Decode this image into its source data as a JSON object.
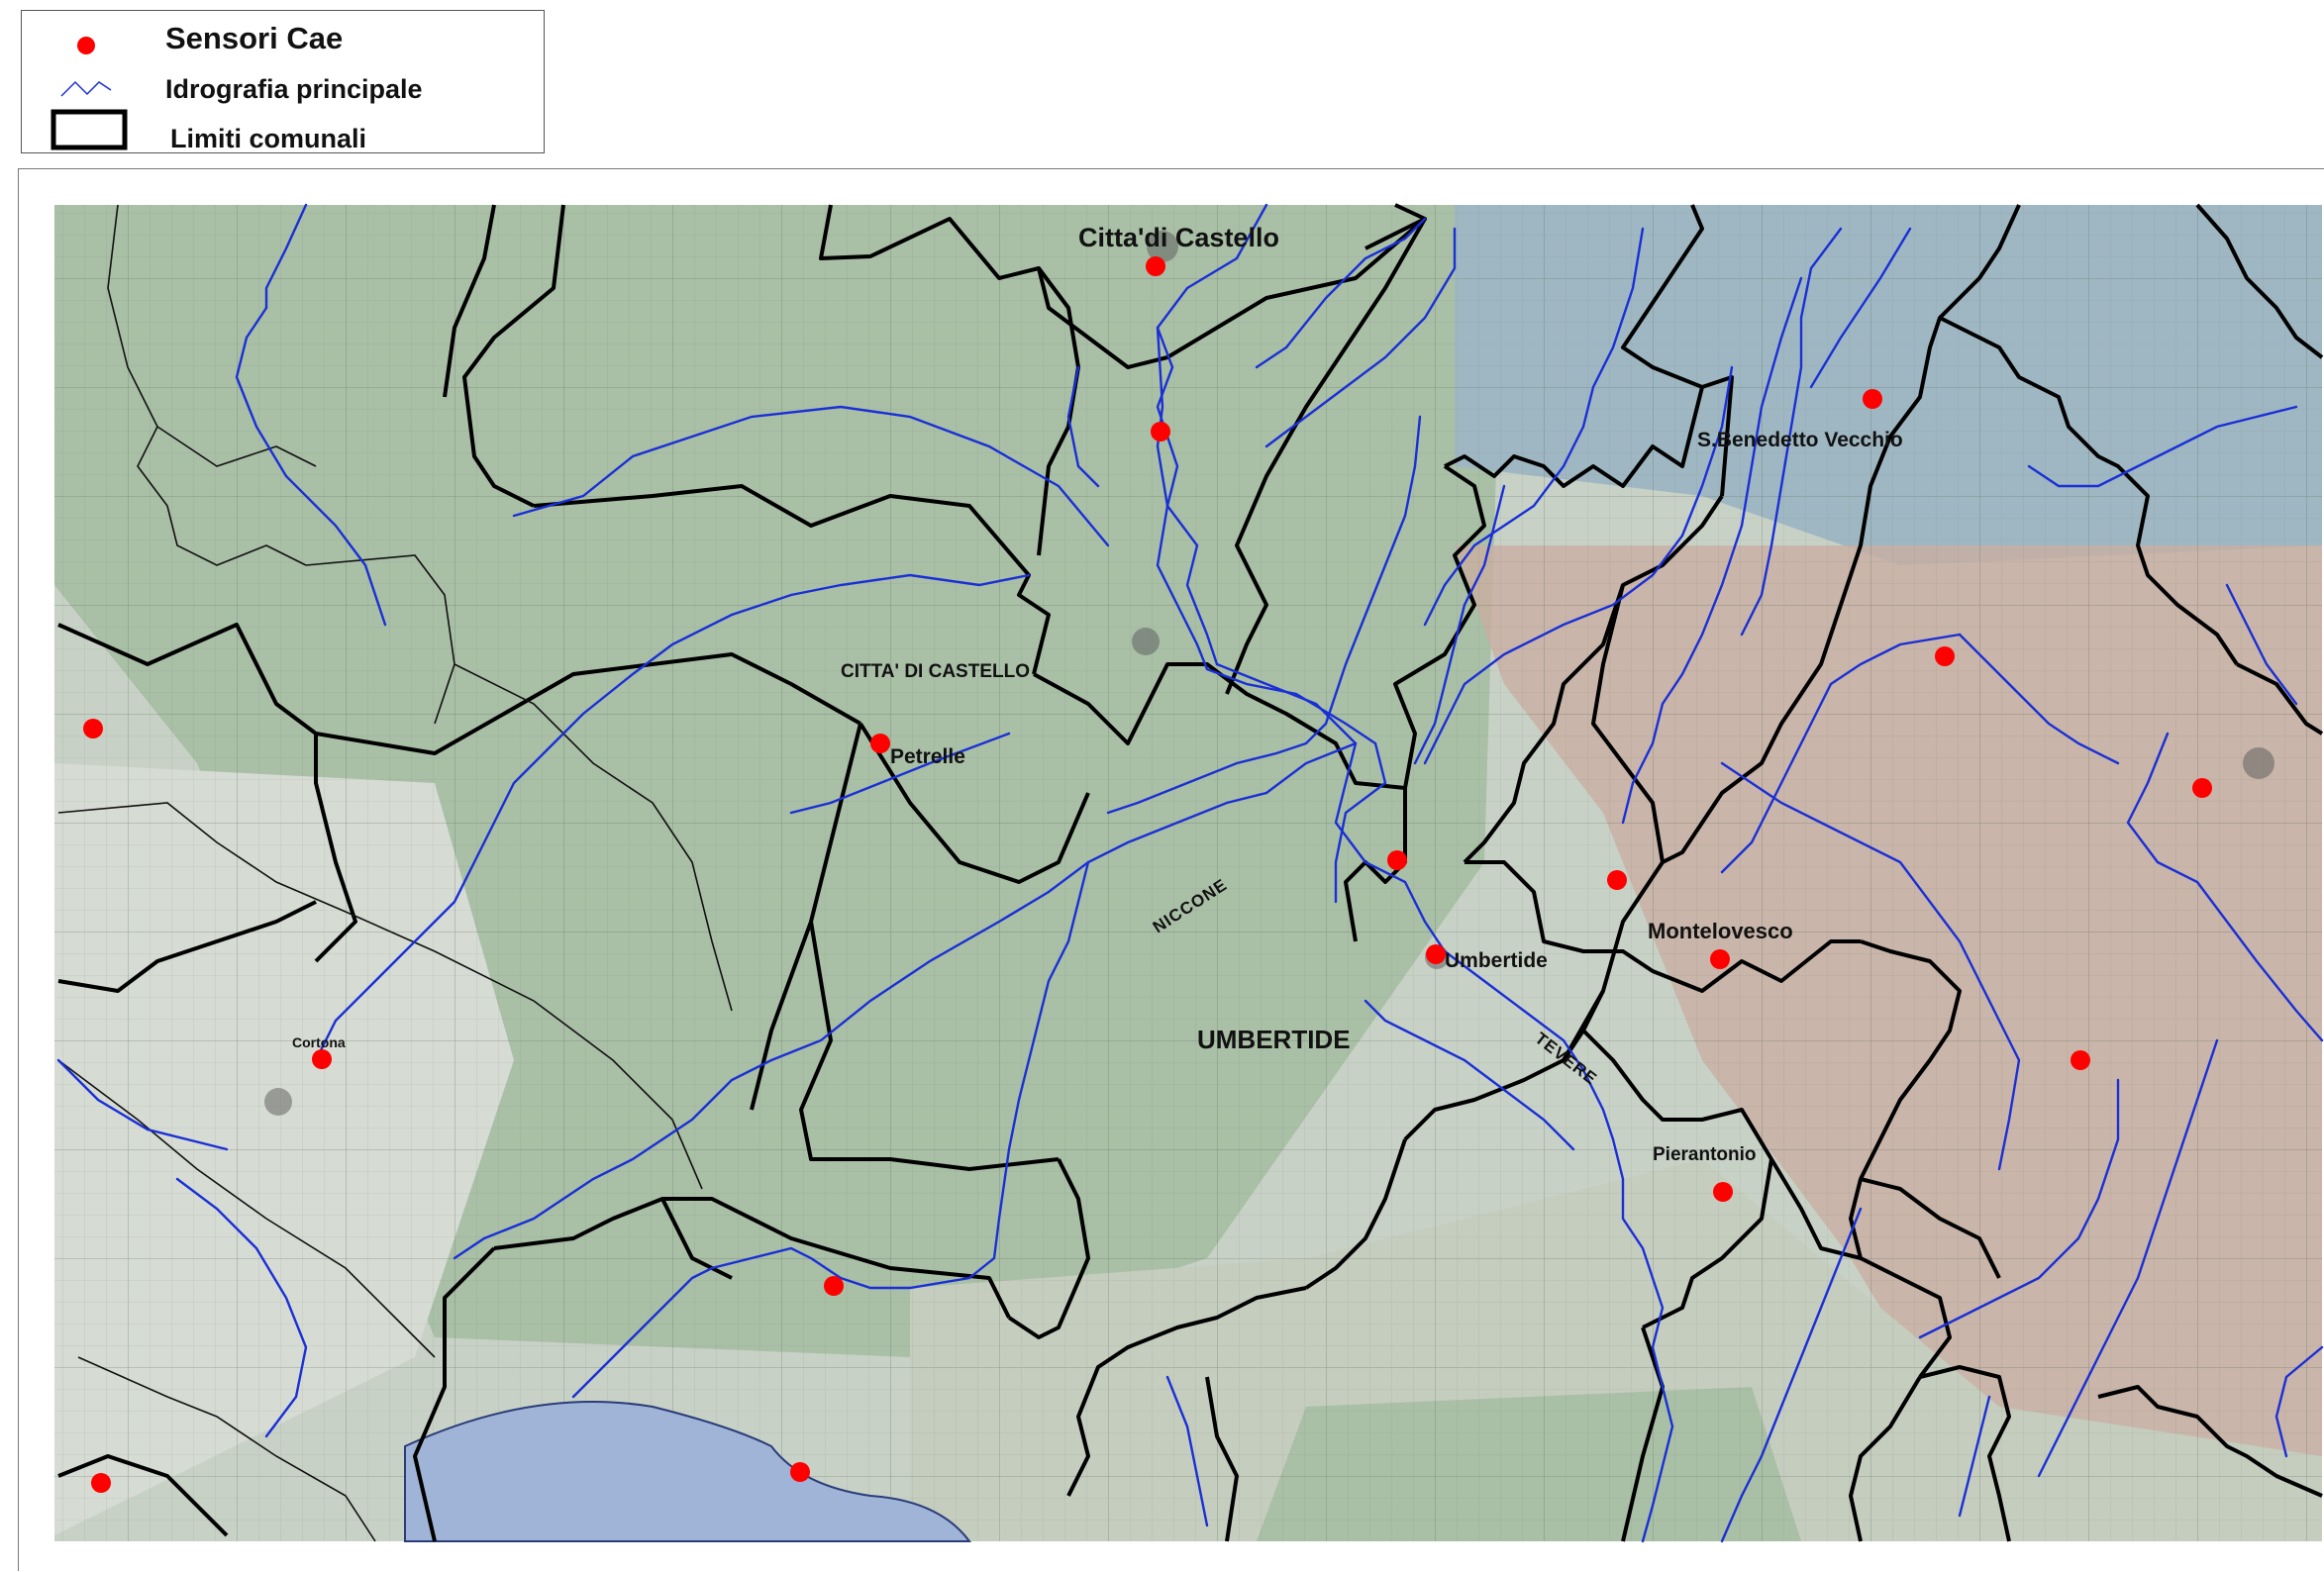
{
  "legend": {
    "items": [
      {
        "label": "Sensori Cae",
        "symbol": "red-dot-icon",
        "color": "#ff0000"
      },
      {
        "label": "Idrografia principale",
        "symbol": "river-line-icon",
        "color": "#1a2fd6"
      },
      {
        "label": "Limiti comunali",
        "symbol": "boundary-box-icon",
        "color": "#000000"
      }
    ]
  },
  "map": {
    "colors": {
      "sensor": "#ff0000",
      "river": "#1a2fd6",
      "boundary": "#000000",
      "terrain_green": "#a9bfa6",
      "terrain_blue": "#9fb7c2",
      "terrain_brown": "#c9aea1",
      "lake": "#9fb4d6"
    },
    "place_labels": {
      "citta_di_castello_town": "Citta'di Castello",
      "citta_di_castello_comune": "CITTA' DI CASTELLO",
      "petrelle": "Petrelle",
      "san_benedetto_vecchio": "S.Benedetto Vecchio",
      "montelovesco": "Montelovesco",
      "umbertide_town": "Umbertide",
      "umbertide_comune": "UMBERTIDE",
      "pierantonio": "Pierantonio",
      "cortona": "Cortona"
    },
    "river_labels": {
      "niccone": "NICCONE",
      "tevere": "TEVERE"
    },
    "sensor_count": 21
  }
}
